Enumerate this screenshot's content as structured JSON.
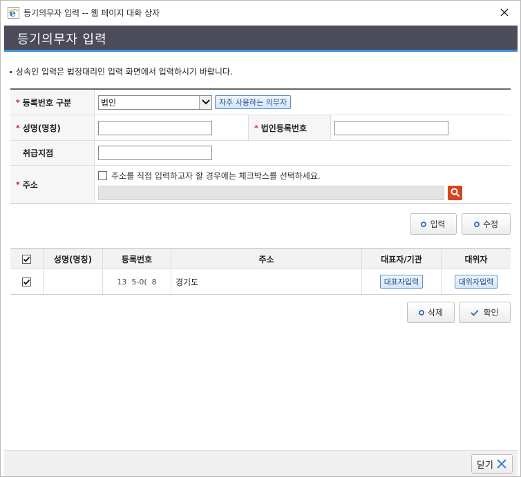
{
  "window": {
    "title": "등기의무자 입력 -- 웹 페이지 대화 상자"
  },
  "header": {
    "title": "등기의무자 입력"
  },
  "notice": "상속인 입력은 법정대리인 입력 화면에서 입력하시기 바랍니다.",
  "form": {
    "reg_type_label": "등록번호 구분",
    "reg_type_value": "법인",
    "frequent_button": "자주 사용하는 의무자",
    "name_label": "성명(명칭)",
    "name_value": "",
    "corp_no_label": "법인등록번호",
    "corp_no_value": "",
    "branch_label": "취급지점",
    "branch_value": "",
    "address_label": "주소",
    "address_checkbox_text": "주소를 직접 입력하고자 할 경우에는 체크박스를 선택하세요.",
    "address_value": ""
  },
  "actions": {
    "input": "입력",
    "edit": "수정",
    "delete": "삭제",
    "confirm": "확인"
  },
  "grid": {
    "headers": [
      "성명(명칭)",
      "등록번호",
      "주소",
      "대표자/기관",
      "대위자"
    ],
    "rows": [
      {
        "name": "",
        "reg_no": "13  5-0(  8",
        "address": "경기도",
        "rep_button": "대표자입력",
        "subrogate_button": "대위자입력"
      }
    ]
  },
  "footer": {
    "close": "닫기"
  },
  "colors": {
    "header_bg": "#4b4b5a",
    "accent": "#3b8fd8",
    "required": "#d02020",
    "search": "#d5441c"
  }
}
